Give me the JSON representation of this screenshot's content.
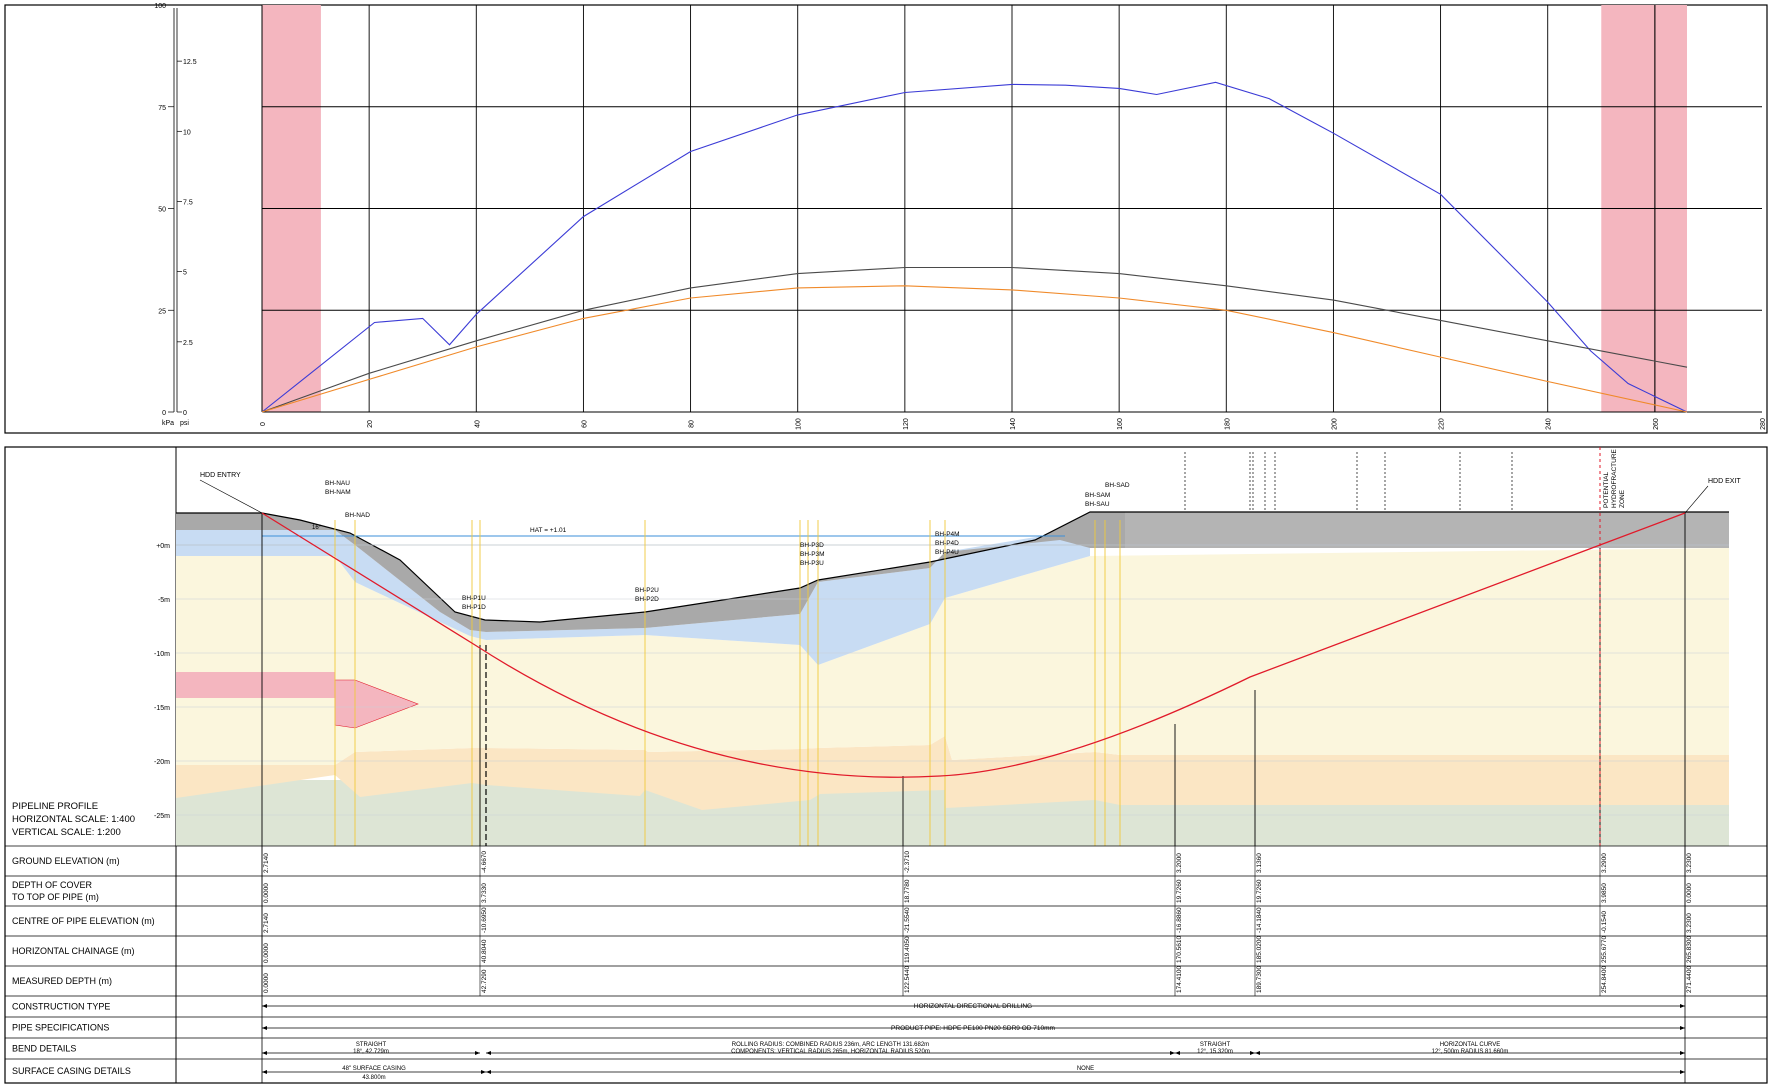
{
  "colors": {
    "frame": "#000000",
    "safety_zone": "#f4b6bf",
    "series_blue": "#3b3bd6",
    "series_black": "#4a4a4a",
    "series_orange": "#f08a2a",
    "ground_top": "#a9a9a9",
    "upper_layer": "#c8dcf3",
    "middle_layer": "#fbf6dd",
    "lower_layer": "#fbe6c4",
    "bottom_layer": "#dde5d5",
    "pipe": "#e11a2a",
    "hat_line": "#3b8fd9"
  },
  "top_chart": {
    "left_axis_unit": "kPa",
    "right_axis_unit": "psi",
    "left_ticks": [
      "100",
      "75",
      "50",
      "25",
      "0"
    ],
    "right_ticks": [
      "12.5",
      "10",
      "7.5",
      "5",
      "2.5",
      "0"
    ],
    "x_ticks": [
      "0",
      "20",
      "40",
      "60",
      "80",
      "100",
      "120",
      "140",
      "160",
      "180",
      "200",
      "220",
      "240",
      "260",
      "280"
    ]
  },
  "chart_data": {
    "type": "line",
    "x_range": [
      0,
      280
    ],
    "y_range_kpa": [
      0,
      100
    ],
    "safety_zones": [
      [
        0,
        11
      ],
      [
        250,
        266
      ]
    ],
    "series": [
      {
        "color": "blue",
        "x": [
          0,
          21,
          30,
          35,
          40,
          60,
          80,
          100,
          120,
          140,
          150,
          160,
          167,
          178,
          188,
          200,
          220,
          240,
          248,
          255,
          266
        ],
        "y": [
          0,
          22,
          23,
          16.5,
          24,
          48,
          64,
          73,
          78.5,
          80.5,
          80.3,
          79.5,
          78,
          81,
          77,
          68.5,
          53.5,
          27,
          15,
          7,
          0
        ]
      },
      {
        "color": "black",
        "x": [
          0,
          20,
          40,
          60,
          80,
          100,
          120,
          140,
          160,
          180,
          200,
          220,
          240,
          266
        ],
        "y": [
          0,
          9.5,
          17.5,
          25,
          30.5,
          34,
          35.5,
          35.5,
          34,
          31,
          27.5,
          22.5,
          17.5,
          11
        ]
      },
      {
        "color": "orange",
        "x": [
          0,
          20,
          40,
          60,
          80,
          100,
          120,
          140,
          160,
          180,
          200,
          220,
          240,
          266
        ],
        "y": [
          0,
          8,
          16,
          23,
          28,
          30.5,
          31,
          30,
          28,
          25,
          19.5,
          13.5,
          7.5,
          0
        ]
      }
    ]
  },
  "profile": {
    "title_line1": "PIPELINE PROFILE",
    "title_line2": "HORIZONTAL SCALE: 1:400",
    "title_line3": "VERTICAL SCALE: 1:200",
    "depth_labels": [
      "+0m",
      "-5m",
      "-10m",
      "-15m",
      "-20m",
      "-25m"
    ],
    "hdd_entry": "HDD ENTRY",
    "hdd_exit": "HDD EXIT",
    "hat_label": "HAT = +1.01",
    "angle_label": "16°",
    "fracture_zone": [
      "POTENTIAL",
      "HYDROFRACTURE",
      "ZONE"
    ],
    "boreholes": [
      {
        "lines": [
          "BH-NAU",
          "BH-NAM"
        ]
      },
      {
        "lines": [
          "BH-NAD"
        ]
      },
      {
        "lines": [
          "BH-P1U",
          "BH-P1D"
        ]
      },
      {
        "lines": [
          "BH-P2U",
          "BH-P2D"
        ]
      },
      {
        "lines": [
          "BH-P3D",
          "BH-P3M",
          "BH-P3U"
        ]
      },
      {
        "lines": [
          "BH-P4M",
          "BH-P4D",
          "BH-P4U"
        ]
      },
      {
        "lines": [
          "BH-SAD"
        ]
      },
      {
        "lines": [
          "BH-SAM",
          "BH-SAU"
        ]
      }
    ]
  },
  "table": {
    "row_labels": [
      [
        "GROUND ELEVATION (m)"
      ],
      [
        "DEPTH OF COVER",
        "TO TOP OF PIPE (m)"
      ],
      [
        "CENTRE OF PIPE ELEVATION (m)"
      ],
      [
        "HORIZONTAL CHAINAGE (m)"
      ],
      [
        "MEASURED DEPTH (m)"
      ],
      [
        "CONSTRUCTION TYPE"
      ],
      [
        "PIPE SPECIFICATIONS"
      ],
      [
        "BEND DETAILS"
      ],
      [
        "SURFACE CASING DETAILS"
      ]
    ],
    "stations": [
      {
        "ground": "2.7140",
        "cover": "0.0000",
        "centre": "2.7140",
        "chainage": "0.0000",
        "measured": "0.0000"
      },
      {
        "ground": "-4.6670",
        "cover": "3.7330",
        "centre": "-10.6950",
        "chainage": "40.8040",
        "measured": "42.7290"
      },
      {
        "ground": "-2.3710",
        "cover": "18.7780",
        "centre": "-21.5540",
        "chainage": "119.4050",
        "measured": "122.5440"
      },
      {
        "ground": "3.2000",
        "cover": "19.7260",
        "centre": "-16.8860",
        "chainage": "170.5610",
        "measured": "174.4100"
      },
      {
        "ground": "3.1360",
        "cover": "19.7260",
        "centre": "-14.1840",
        "chainage": "185.0200",
        "measured": "189.7300"
      },
      {
        "ground": "3.2900",
        "cover": "3.9850",
        "centre": "-0.1540",
        "chainage": "255.6770",
        "measured": "254.8400"
      },
      {
        "ground": "3.2300",
        "cover": "0.0000",
        "centre": "3.2300",
        "chainage": "265.8300",
        "measured": "271.4400"
      }
    ],
    "construction_type": "HORIZONTAL DIRECTIONAL DRILLING",
    "pipe_spec": "PRODUCT PIPE: HDPE PE100 PN20 SDR9 OD 710mm",
    "bends": [
      {
        "l1": "STRAIGHT",
        "l2": "18°, 42.729m"
      },
      {
        "l1": "ROLLING RADIUS: COMBINED RADIUS 236m, ARC LENGTH 131.682m",
        "l2": "COMPONENTS: VERTICAL RADIUS 265m, HORIZONTAL RADIUS 520m"
      },
      {
        "l1": "STRAIGHT",
        "l2": "12°, 15.320m"
      },
      {
        "l1": "HORIZONTAL CURVE",
        "l2": "12°, 500m RADIUS 81.660m"
      }
    ],
    "casing": [
      {
        "l1": "48\" SURFACE CASING",
        "l2": "43.800m"
      },
      {
        "l1": "NONE",
        "l2": ""
      }
    ]
  }
}
